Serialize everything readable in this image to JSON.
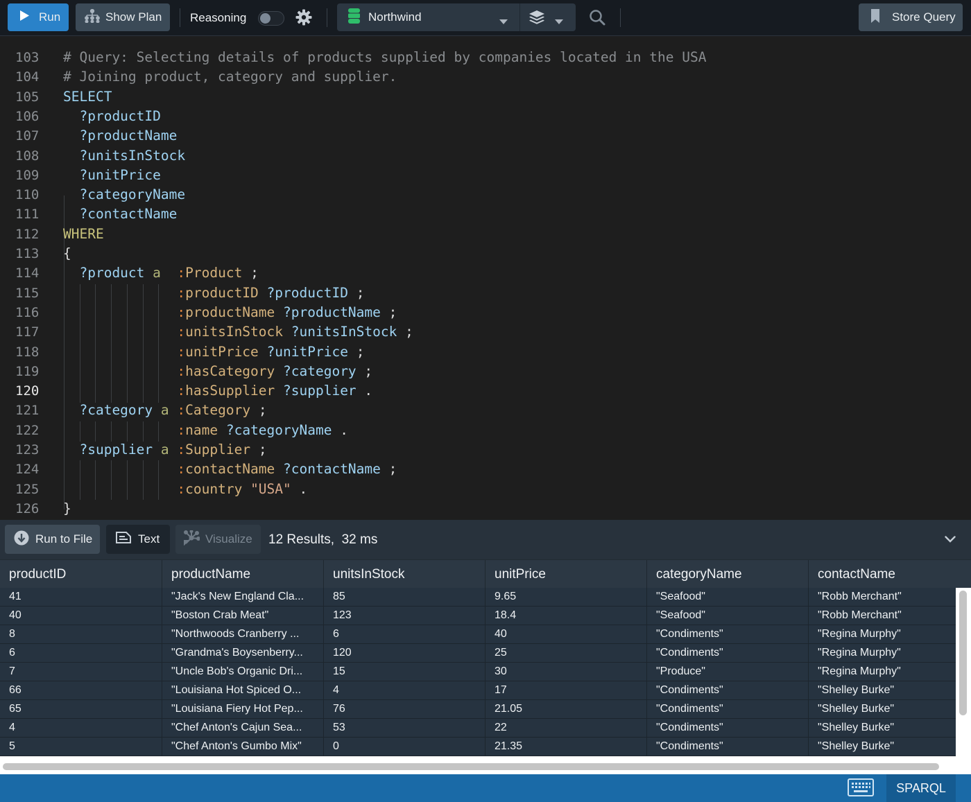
{
  "toolbar": {
    "run_label": "Run",
    "show_plan_label": "Show Plan",
    "reasoning_label": "Reasoning",
    "reasoning_enabled": false,
    "database": "Northwind",
    "store_query_label": "Store Query",
    "icons": {
      "run": "play-icon",
      "plan": "hierarchy-icon",
      "settings": "gear-icon",
      "database": "database-icon",
      "layers": "layers-icon",
      "search": "search-icon",
      "bookmark": "bookmark-icon"
    },
    "colors": {
      "run_button": "#2a82c9",
      "database_icon": "#2fbd6a"
    }
  },
  "editor": {
    "active_line": 120,
    "lines": [
      {
        "n": "103",
        "tokens": [
          [
            "c-comment",
            "# Query: Selecting details of products supplied by companies located in the USA"
          ]
        ]
      },
      {
        "n": "104",
        "tokens": [
          [
            "c-comment",
            "# Joining product, category and supplier."
          ]
        ]
      },
      {
        "n": "105",
        "tokens": [
          [
            "c-kw",
            "SELECT"
          ]
        ]
      },
      {
        "n": "106",
        "tokens": [
          [
            "",
            "  "
          ],
          [
            "c-var",
            "?productID"
          ]
        ]
      },
      {
        "n": "107",
        "tokens": [
          [
            "",
            "  "
          ],
          [
            "c-var",
            "?productName"
          ]
        ]
      },
      {
        "n": "108",
        "tokens": [
          [
            "",
            "  "
          ],
          [
            "c-var",
            "?unitsInStock"
          ]
        ]
      },
      {
        "n": "109",
        "tokens": [
          [
            "",
            "  "
          ],
          [
            "c-var",
            "?unitPrice"
          ]
        ]
      },
      {
        "n": "110",
        "tokens": [
          [
            "",
            "  "
          ],
          [
            "c-var",
            "?categoryName"
          ]
        ]
      },
      {
        "n": "111",
        "tokens": [
          [
            "",
            "  "
          ],
          [
            "c-var",
            "?contactName"
          ]
        ]
      },
      {
        "n": "112",
        "tokens": [
          [
            "c-where",
            "WHERE"
          ]
        ]
      },
      {
        "n": "113",
        "tokens": [
          [
            "c-punct",
            "{"
          ]
        ]
      },
      {
        "n": "114",
        "tokens": [
          [
            "",
            "  "
          ],
          [
            "c-var",
            "?product"
          ],
          [
            "",
            " "
          ],
          [
            "c-a",
            "a"
          ],
          [
            "",
            "  "
          ],
          [
            "c-colon",
            ":"
          ],
          [
            "c-class",
            "Product"
          ],
          [
            "c-punct",
            " ;"
          ]
        ]
      },
      {
        "n": "115",
        "tokens": [
          [
            "",
            "              "
          ],
          [
            "c-colon",
            ":"
          ],
          [
            "c-class",
            "productID"
          ],
          [
            "",
            " "
          ],
          [
            "c-var",
            "?productID"
          ],
          [
            "c-punct",
            " ;"
          ]
        ]
      },
      {
        "n": "116",
        "tokens": [
          [
            "",
            "              "
          ],
          [
            "c-colon",
            ":"
          ],
          [
            "c-class",
            "productName"
          ],
          [
            "",
            " "
          ],
          [
            "c-var",
            "?productName"
          ],
          [
            "c-punct",
            " ;"
          ]
        ]
      },
      {
        "n": "117",
        "tokens": [
          [
            "",
            "              "
          ],
          [
            "c-colon",
            ":"
          ],
          [
            "c-class",
            "unitsInStock"
          ],
          [
            "",
            " "
          ],
          [
            "c-var",
            "?unitsInStock"
          ],
          [
            "c-punct",
            " ;"
          ]
        ]
      },
      {
        "n": "118",
        "tokens": [
          [
            "",
            "              "
          ],
          [
            "c-colon",
            ":"
          ],
          [
            "c-class",
            "unitPrice"
          ],
          [
            "",
            " "
          ],
          [
            "c-var",
            "?unitPrice"
          ],
          [
            "c-punct",
            " ;"
          ]
        ]
      },
      {
        "n": "119",
        "tokens": [
          [
            "",
            "              "
          ],
          [
            "c-colon",
            ":"
          ],
          [
            "c-class",
            "hasCategory"
          ],
          [
            "",
            " "
          ],
          [
            "c-var",
            "?category"
          ],
          [
            "c-punct",
            " ;"
          ]
        ]
      },
      {
        "n": "120",
        "tokens": [
          [
            "",
            "              "
          ],
          [
            "c-colon",
            ":"
          ],
          [
            "c-class",
            "hasSupplier"
          ],
          [
            "",
            " "
          ],
          [
            "c-var",
            "?supplier"
          ],
          [
            "c-punct",
            " ."
          ]
        ]
      },
      {
        "n": "121",
        "tokens": [
          [
            "",
            "  "
          ],
          [
            "c-var",
            "?category"
          ],
          [
            "",
            " "
          ],
          [
            "c-a",
            "a"
          ],
          [
            "",
            " "
          ],
          [
            "c-colon",
            ":"
          ],
          [
            "c-class",
            "Category"
          ],
          [
            "c-punct",
            " ;"
          ]
        ]
      },
      {
        "n": "122",
        "tokens": [
          [
            "",
            "              "
          ],
          [
            "c-colon",
            ":"
          ],
          [
            "c-class",
            "name"
          ],
          [
            "",
            " "
          ],
          [
            "c-var",
            "?categoryName"
          ],
          [
            "c-punct",
            " ."
          ]
        ]
      },
      {
        "n": "123",
        "tokens": [
          [
            "",
            "  "
          ],
          [
            "c-var",
            "?supplier"
          ],
          [
            "",
            " "
          ],
          [
            "c-a",
            "a"
          ],
          [
            "",
            " "
          ],
          [
            "c-colon",
            ":"
          ],
          [
            "c-class",
            "Supplier"
          ],
          [
            "c-punct",
            " ;"
          ]
        ]
      },
      {
        "n": "124",
        "tokens": [
          [
            "",
            "              "
          ],
          [
            "c-colon",
            ":"
          ],
          [
            "c-class",
            "contactName"
          ],
          [
            "",
            " "
          ],
          [
            "c-var",
            "?contactName"
          ],
          [
            "c-punct",
            " ;"
          ]
        ]
      },
      {
        "n": "125",
        "tokens": [
          [
            "",
            "              "
          ],
          [
            "c-colon",
            ":"
          ],
          [
            "c-class",
            "country"
          ],
          [
            "",
            " "
          ],
          [
            "c-str",
            "\"USA\""
          ],
          [
            "c-punct",
            " ."
          ]
        ]
      },
      {
        "n": "126",
        "tokens": [
          [
            "c-punct",
            "}"
          ]
        ]
      }
    ]
  },
  "results": {
    "run_to_file_label": "Run to File",
    "text_label": "Text",
    "visualize_label": "Visualize",
    "summary": "12 Results,  32 ms",
    "columns": [
      "productID",
      "productName",
      "unitsInStock",
      "unitPrice",
      "categoryName",
      "contactName"
    ],
    "rows": [
      [
        "41",
        "\"Jack's New England Cla...",
        "85",
        "9.65",
        "\"Seafood\"",
        "\"Robb Merchant\""
      ],
      [
        "40",
        "\"Boston Crab Meat\"",
        "123",
        "18.4",
        "\"Seafood\"",
        "\"Robb Merchant\""
      ],
      [
        "8",
        "\"Northwoods Cranberry ...",
        "6",
        "40",
        "\"Condiments\"",
        "\"Regina Murphy\""
      ],
      [
        "6",
        "\"Grandma's Boysenberry...",
        "120",
        "25",
        "\"Condiments\"",
        "\"Regina Murphy\""
      ],
      [
        "7",
        "\"Uncle Bob's Organic Dri...",
        "15",
        "30",
        "\"Produce\"",
        "\"Regina Murphy\""
      ],
      [
        "66",
        "\"Louisiana Hot Spiced O...",
        "4",
        "17",
        "\"Condiments\"",
        "\"Shelley Burke\""
      ],
      [
        "65",
        "\"Louisiana Fiery Hot Pep...",
        "76",
        "21.05",
        "\"Condiments\"",
        "\"Shelley Burke\""
      ],
      [
        "4",
        "\"Chef Anton's Cajun Sea...",
        "53",
        "22",
        "\"Condiments\"",
        "\"Shelley Burke\""
      ],
      [
        "5",
        "\"Chef Anton's Gumbo Mix\"",
        "0",
        "21.35",
        "\"Condiments\"",
        "\"Shelley Burke\""
      ]
    ]
  },
  "statusbar": {
    "language": "SPARQL",
    "keyboard_icon": "keyboard-icon"
  }
}
